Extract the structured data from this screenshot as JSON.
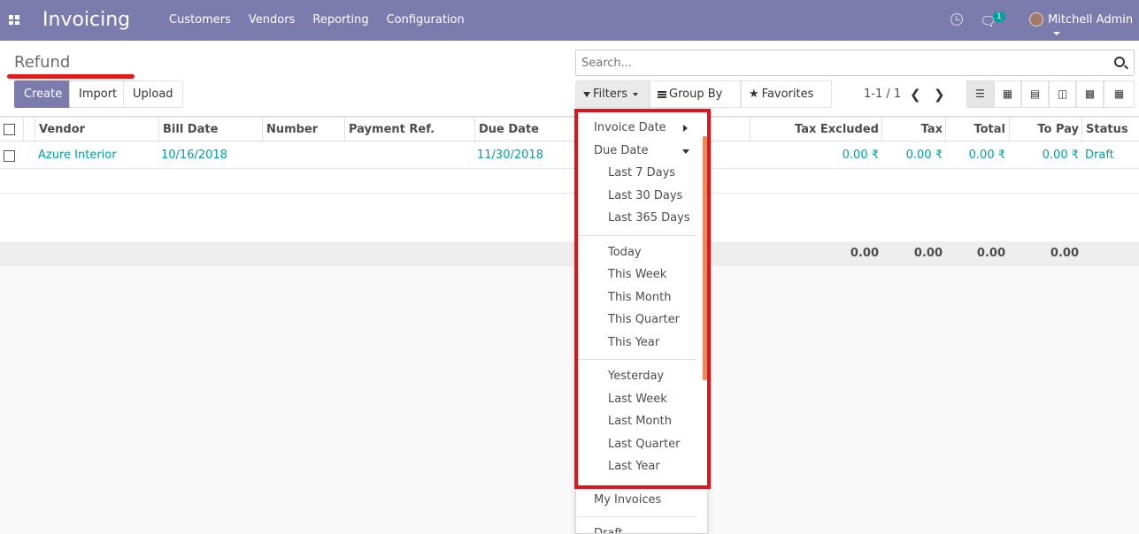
{
  "topbar": {
    "app_title": "Invoicing",
    "menu": [
      "Customers",
      "Vendors",
      "Reporting",
      "Configuration"
    ],
    "chat_badge": "1",
    "user_name": "Mitchell Admin"
  },
  "control": {
    "breadcrumb": "Refund",
    "buttons": {
      "create": "Create",
      "import": "Import",
      "upload": "Upload"
    },
    "search_placeholder": "Search...",
    "filters_label": "Filters",
    "groupby_label": "Group By",
    "favorites_label": "Favorites",
    "pager": "1-1 / 1"
  },
  "table": {
    "columns": {
      "vendor": "Vendor",
      "bill_date": "Bill Date",
      "number": "Number",
      "payment_ref": "Payment Ref.",
      "due_date": "Due Date",
      "tax_excluded": "Tax Excluded",
      "tax": "Tax",
      "total": "Total",
      "to_pay": "To Pay",
      "status": "Status"
    },
    "rows": [
      {
        "vendor": "Azure Interior",
        "bill_date": "10/16/2018",
        "due_date": "11/30/2018",
        "tax_excluded": "0.00 ₹",
        "tax": "0.00 ₹",
        "total": "0.00 ₹",
        "to_pay": "0.00 ₹",
        "status": "Draft"
      }
    ],
    "totals": {
      "tax_excluded": "0.00",
      "tax": "0.00",
      "total": "0.00",
      "to_pay": "0.00"
    }
  },
  "filters_menu": {
    "invoice_date": "Invoice Date",
    "due_date": "Due Date",
    "group1": [
      "Last 7 Days",
      "Last 30 Days",
      "Last 365 Days"
    ],
    "group2": [
      "Today",
      "This Week",
      "This Month",
      "This Quarter",
      "This Year"
    ],
    "group3": [
      "Yesterday",
      "Last Week",
      "Last Month",
      "Last Quarter",
      "Last Year"
    ],
    "my_invoices": "My Invoices",
    "draft": "Draft"
  },
  "colors": {
    "brand": "#7c7bad",
    "link": "#00a09d",
    "highlight": "#e0141a"
  }
}
